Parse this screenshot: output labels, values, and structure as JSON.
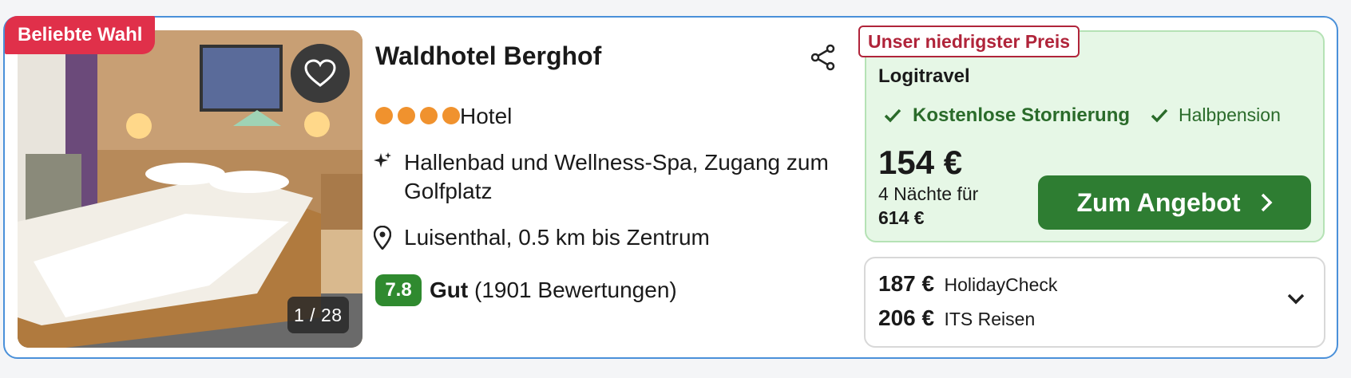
{
  "badge": "Beliebte Wahl",
  "gallery": {
    "counter": "1 / 28"
  },
  "hotel": {
    "name": "Waldhotel Berghof",
    "stars": 4,
    "type": "Hotel",
    "feature": "Hallenbad und Wellness-Spa, Zugang zum Golfplatz",
    "location": "Luisenthal, 0.5 km bis Zentrum",
    "score": "7.8",
    "score_label": "Gut",
    "reviews": "(1901 Bewertungen)"
  },
  "best_offer": {
    "tag": "Unser niedrigster Preis",
    "provider": "Logitravel",
    "cancellation": "Kostenlose Stornierung",
    "board": "Halbpension",
    "price": "154 €",
    "nights_text": "4 Nächte für",
    "total": "614 €",
    "cta": "Zum Angebot"
  },
  "other_offers": [
    {
      "price": "187 €",
      "provider": "HolidayCheck"
    },
    {
      "price": "206 €",
      "provider": "ITS Reisen"
    }
  ],
  "colors": {
    "badge": "#e0304a",
    "accent_border": "#4a90d9",
    "cta": "#2e7d32",
    "star": "#f0922e",
    "score": "#2f8a2f"
  }
}
